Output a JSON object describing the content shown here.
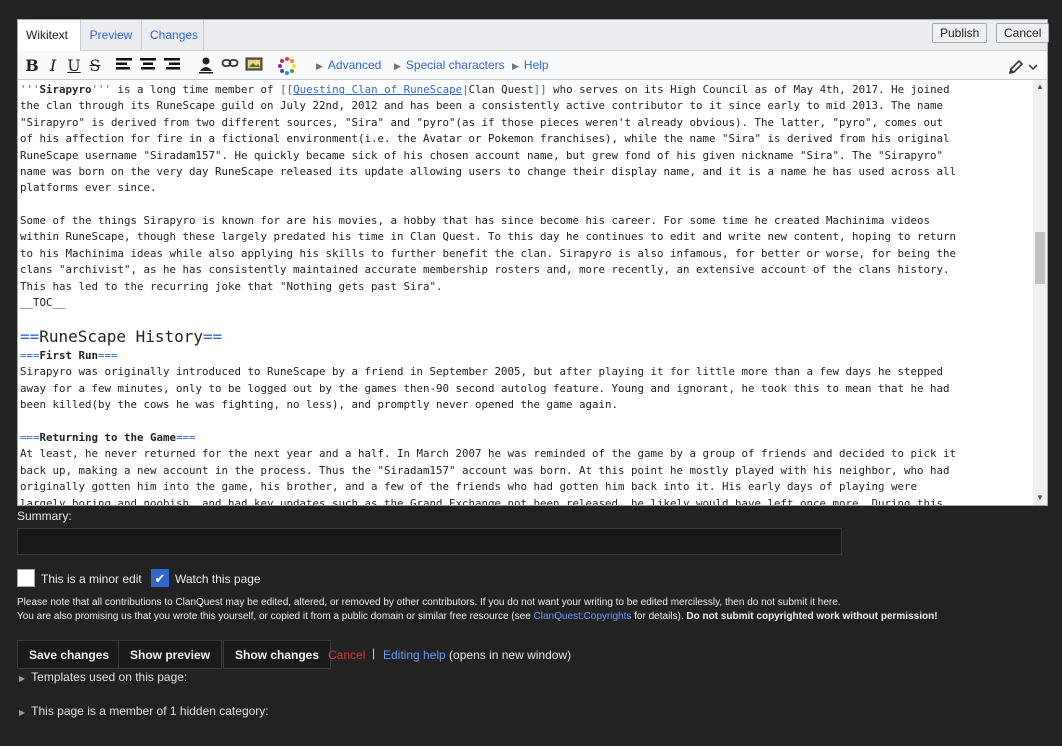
{
  "tabs": {
    "wikitext": "Wikitext",
    "preview": "Preview",
    "changes": "Changes"
  },
  "top_buttons": {
    "publish": "Publish",
    "cancel": "Cancel"
  },
  "toolbar": {
    "bold": "B",
    "italic": "I",
    "underline": "U",
    "strike": "S",
    "advanced": "Advanced",
    "special_characters": "Special characters",
    "help": "Help"
  },
  "wikitext": {
    "p1_bold_open": "'''",
    "p1_name": "Sirapyro",
    "p1_bold_close": "'''",
    "p1_a": " is a long time member of ",
    "p1_link_open": "[[",
    "p1_link_target": "Questing Clan of RuneScape",
    "p1_link_pipe": "|",
    "p1_link_text": "Clan Quest",
    "p1_link_close": "]]",
    "p1_b": " who serves on its High Council as of May 4th, 2017. He joined",
    "p1_lines": [
      "the clan through its RuneScape guild on July 22nd, 2012 and has been a consistently active contributor to it since early to mid 2013. The name",
      "\"Sirapyro\" is derived from two different sources, \"Sira\" and \"pyro\"(as if those pieces weren't already obvious). The latter, \"pyro\", comes out",
      "of his affection for fire in a fictional environment(i.e. the Avatar or Pokemon franchises), while the name \"Sira\" is derived from his original",
      "RuneScape username \"Siradam157\". He quickly became sick of his chosen account name, but grew fond of his given nickname \"Sira\". The \"Sirapyro\"",
      "name was born on the very day RuneScape released its update allowing users to change their display name, and it is a name he has used across all",
      "platforms ever since."
    ],
    "p2_lines": [
      "Some of the things Sirapyro is known for are his movies, a hobby that has since become his career. For some time he created Machinima videos",
      "within RuneScape, though these largely predated his time in Clan Quest. To this day he continues to edit and write new content, hoping to return",
      "to his Machinima ideas while also applying his skills to further benefit the clan. Sirapyro is also infamous, for better or worse, for being the",
      "clans \"archivist\", as he has consistently maintained accurate membership rosters and, more recently, an extensive account of the clans history.",
      "This has led to the recurring joke that \"Nothing gets past Sira\".",
      "__TOC__"
    ],
    "h2_mark": "==",
    "h2_text": "RuneScape History",
    "h3a_mark": "===",
    "h3a_text": "First Run",
    "p3_lines": [
      "Sirapyro was originally introduced to RuneScape by a friend in September 2005, but after playing it for little more than a few days he stepped",
      "away for a few minutes, only to be logged out by the games then-90 second autolog feature. Young and ignorant, he took this to mean that he had",
      "been killed(by the cows he was fighting, no less), and promptly never opened the game again."
    ],
    "h3b_mark": "===",
    "h3b_text": "Returning to the Game",
    "p4_lines": [
      "At least, he never returned for the next year and a half. In March 2007 he was reminded of the game by a group of friends and decided to pick it",
      "back up, making a new account in the process. Thus the \"Siradam157\" account was born. At this point he mostly played with his neighbor, who had",
      "originally gotten him into the game, his brother, and a few of the friends who had gotten him back into it. His early days of playing were",
      "largely boring and noobish, and had key updates such as the Grand Exchange not been released, he likely would have left once more. During this"
    ]
  },
  "summary": {
    "label": "Summary:",
    "value": ""
  },
  "checkboxes": {
    "minor_edit": "This is a minor edit",
    "watch": "Watch this page"
  },
  "notice": {
    "line1": "Please note that all contributions to ClanQuest may be edited, altered, or removed by other contributors. If you do not want your writing to be edited mercilessly, then do not submit it here.",
    "line2_a": "You are also promising us that you wrote this yourself, or copied it from a public domain or similar free resource (see ",
    "line2_link": "ClanQuest:Copyrights",
    "line2_b": " for details). ",
    "line2_bold": "Do not submit copyrighted work without permission!"
  },
  "actions": {
    "save": "Save changes",
    "preview": "Show preview",
    "changes": "Show changes",
    "cancel": "Cancel",
    "separator": "|",
    "editing_help": "Editing help",
    "help_suffix": " (opens in new window)"
  },
  "collapsibles": {
    "templates": "Templates used on this page:",
    "categories": "This page is a member of 1 hidden category:"
  },
  "colors": {
    "link": "#3366cc",
    "cancel": "#dd3333",
    "checkbox_on": "#3366cc",
    "background": "#222222"
  }
}
